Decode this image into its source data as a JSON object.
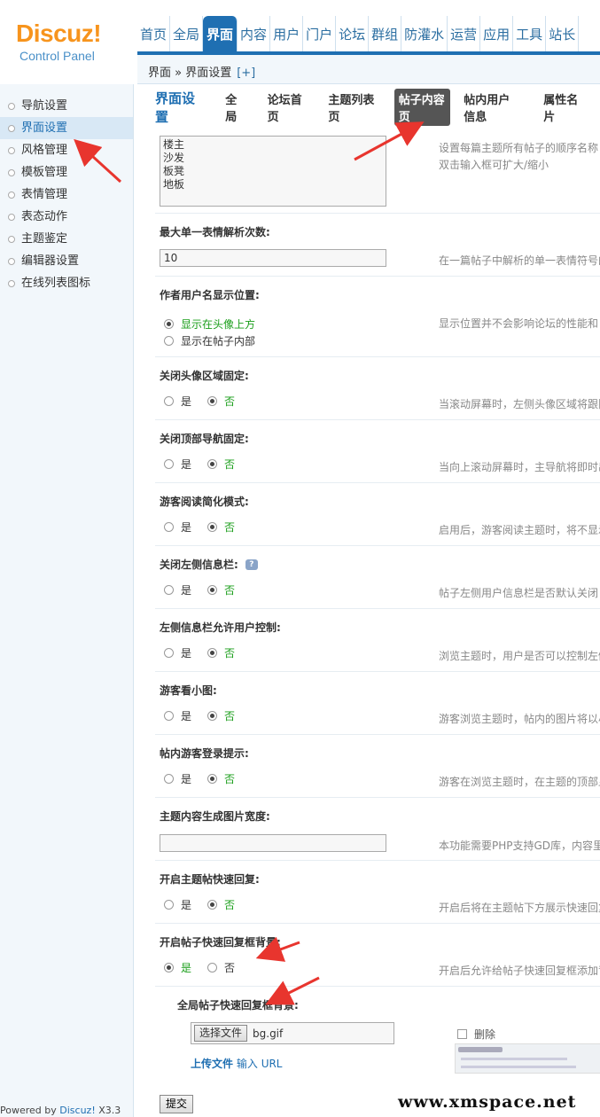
{
  "logo": {
    "brand": "Discuz!",
    "sub": "Control Panel"
  },
  "topnav": [
    "首页",
    "全局",
    "界面",
    "内容",
    "用户",
    "门户",
    "论坛",
    "群组",
    "防灌水",
    "运营",
    "应用",
    "工具",
    "站长"
  ],
  "topnav_active_index": 2,
  "breadcrumb": {
    "text": "界面 » 界面设置",
    "plus": "[+]"
  },
  "sidebar": {
    "items": [
      "导航设置",
      "界面设置",
      "风格管理",
      "模板管理",
      "表情管理",
      "表态动作",
      "主题鉴定",
      "编辑器设置",
      "在线列表图标"
    ],
    "active_index": 1
  },
  "powered": {
    "prefix": "Powered by ",
    "brand": "Discuz!",
    "version": " X3.3"
  },
  "subtabs": {
    "title": "界面设置",
    "tabs": [
      "全局",
      "论坛首页",
      "主题列表页",
      "帖子内容页",
      "帖内用户信息",
      "属性名片"
    ],
    "active_index": 3
  },
  "settings": {
    "floor_names": {
      "value": "楼主\n沙发\n板凳\n地板",
      "desc": "设置每篇主题所有帖子的顺序名称",
      "desc2": "双击输入框可扩大/缩小"
    },
    "smiley_limit": {
      "label": "最大单一表情解析次数:",
      "value": "10",
      "desc": "在一篇帖子中解析的单一表情符号的"
    },
    "author_position": {
      "label": "作者用户名显示位置:",
      "opt1": "显示在头像上方",
      "opt2": "显示在帖子内部",
      "desc": "显示位置并不会影响论坛的性能和"
    },
    "close_avatar_fix": {
      "label": "关闭头像区域固定:",
      "desc": "当滚动屏幕时，左侧头像区域将跟随"
    },
    "close_topnav_fix": {
      "label": "关闭顶部导航固定:",
      "desc": "当向上滚动屏幕时，主导航将即时出"
    },
    "guest_simple": {
      "label": "游客阅读简化模式:",
      "desc": "启用后，游客阅读主题时，将不显示"
    },
    "close_left_info": {
      "label": "关闭左侧信息栏:",
      "tip": "?",
      "desc": "帖子左侧用户信息栏是否默认关闭"
    },
    "left_info_user_ctrl": {
      "label": "左侧信息栏允许用户控制:",
      "desc": "浏览主题时，用户是否可以控制左侧"
    },
    "guest_thumb": {
      "label": "游客看小图:",
      "desc": "游客浏览主题时，帖内的图片将以小"
    },
    "guest_login_tip": {
      "label": "帖内游客登录提示:",
      "desc": "游客在浏览主题时，在主题的顶部显"
    },
    "image_width": {
      "label": "主题内容生成图片宽度:",
      "value": "",
      "desc": "本功能需要PHP支持GD库，内容里的"
    },
    "quick_reply": {
      "label": "开启主题帖快速回复:",
      "desc": "开启后将在主题帖下方展示快速回复"
    },
    "quick_reply_bg": {
      "label": "开启帖子快速回复框背景:",
      "desc": "开启后允许给帖子快速回复框添加背"
    },
    "global_bg": {
      "label": "全局帖子快速回复框背景:",
      "file_button": "选择文件",
      "file_name": "bg.gif",
      "upload": "上传文件",
      "input": "输入",
      "url": "URL",
      "delete": "删除"
    }
  },
  "yes": "是",
  "no": "否",
  "submit": "提交",
  "watermark": "www.xmspace.net"
}
